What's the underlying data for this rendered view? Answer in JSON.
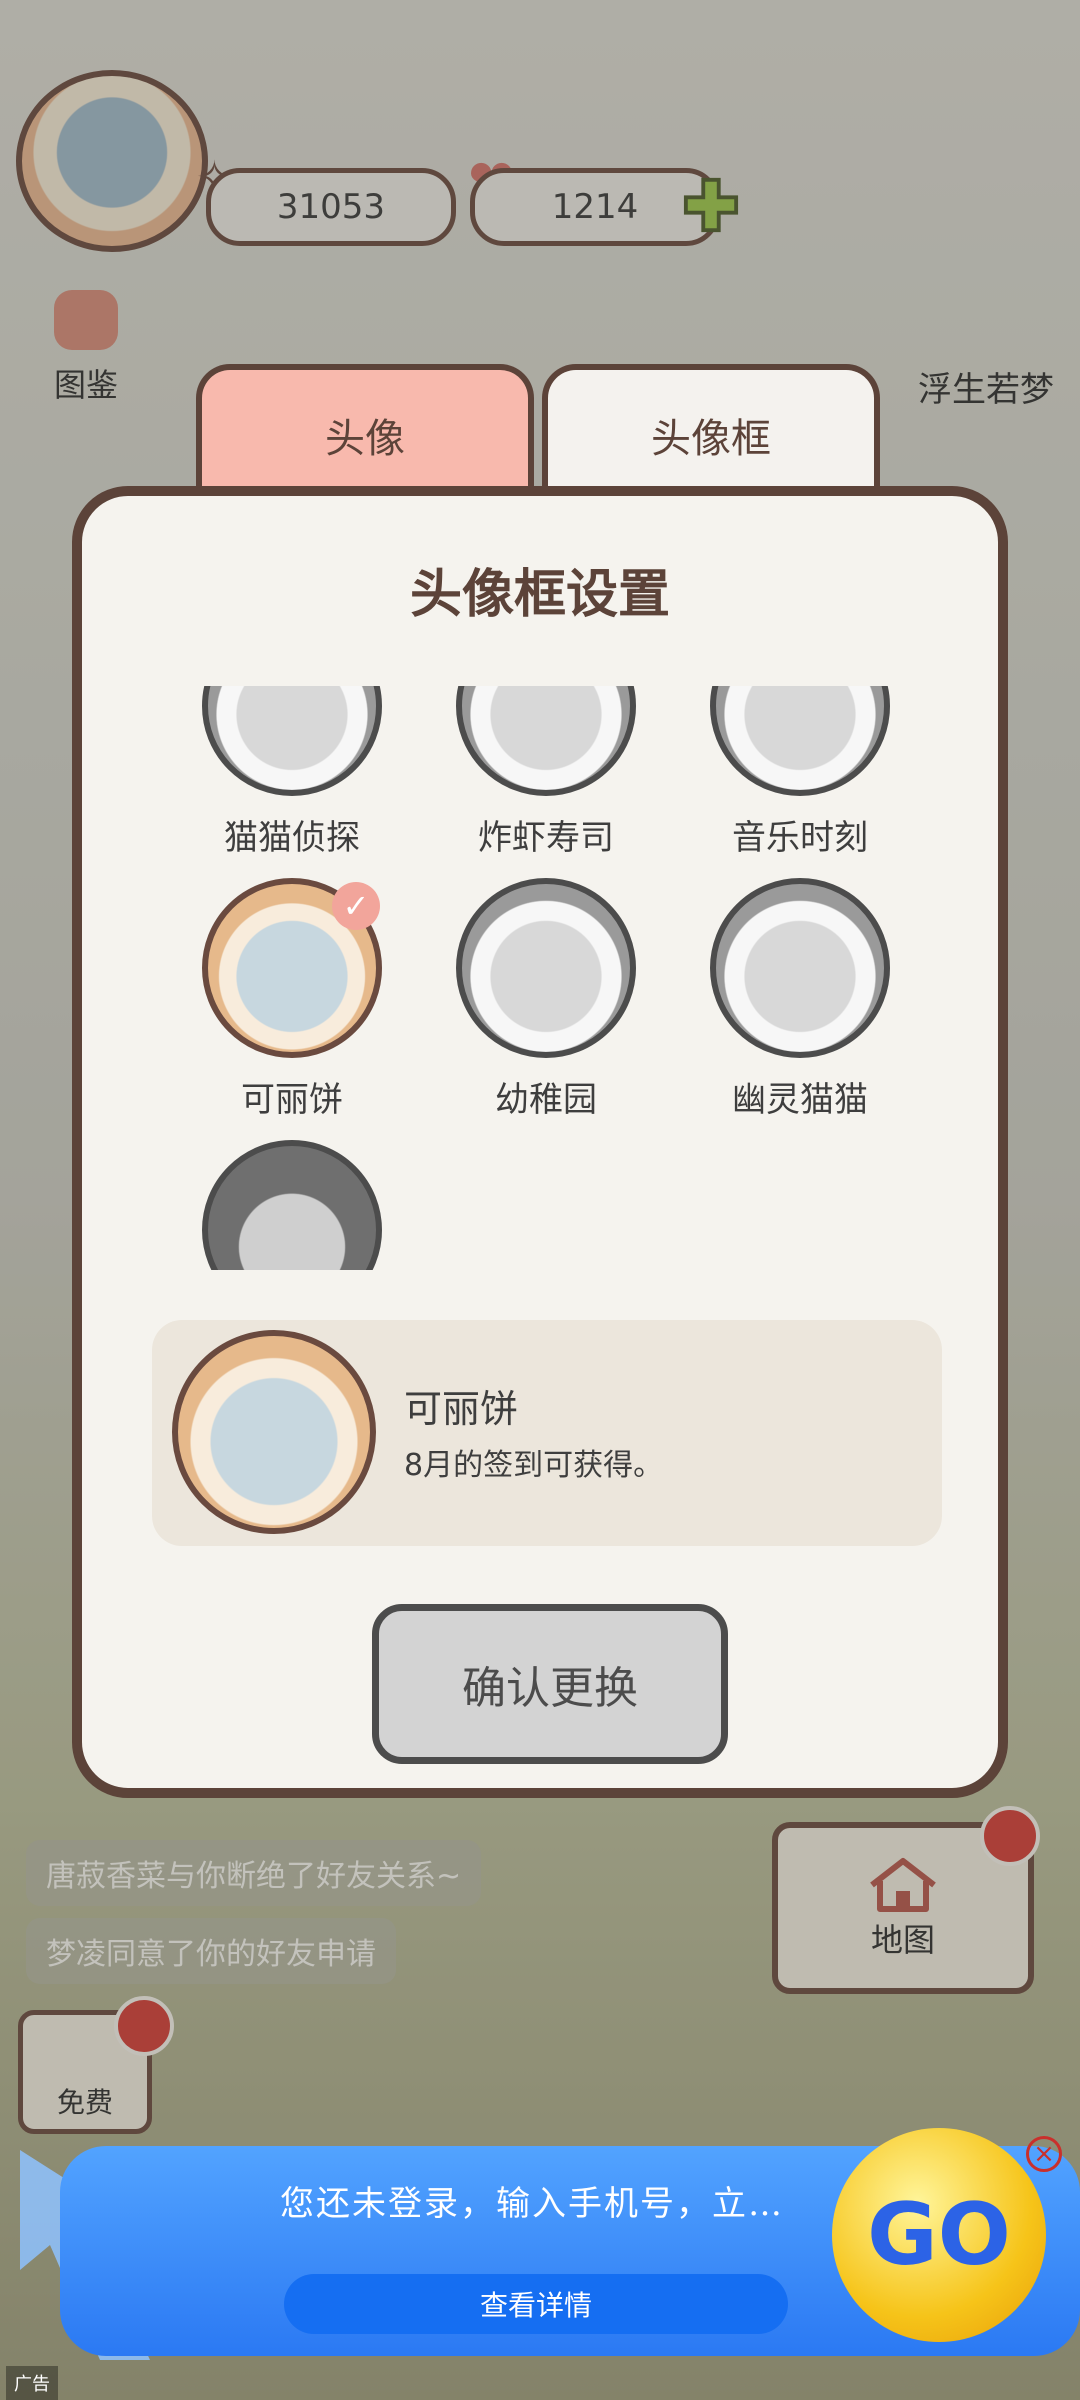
{
  "hud": {
    "fish_count": "31053",
    "heart_count": "1214"
  },
  "menu": [
    {
      "label": "图鉴"
    }
  ],
  "corner_name": "浮生若梦",
  "log_messages": [
    "唐菽香菜与你断绝了好友关系~",
    "梦凌同意了你的好友申请"
  ],
  "map_label": "地图",
  "free_label": "免费",
  "modal": {
    "tabs": [
      "头像",
      "头像框"
    ],
    "active_tab": "头像框",
    "title": "头像框设置",
    "frames": [
      {
        "name": "猫猫侦探",
        "owned": false
      },
      {
        "name": "炸虾寿司",
        "owned": false
      },
      {
        "name": "音乐时刻",
        "owned": false
      },
      {
        "name": "可丽饼",
        "owned": true,
        "selected": true
      },
      {
        "name": "幼稚园",
        "owned": false
      },
      {
        "name": "幽灵猫猫",
        "owned": false
      },
      {
        "name": "",
        "owned": false
      }
    ],
    "detail": {
      "name": "可丽饼",
      "description": "8月的签到可获得。"
    },
    "confirm_label": "确认更换"
  },
  "ad": {
    "text": "您还未登录，输入手机号，立…",
    "button_label": "查看详情",
    "go_label": "GO",
    "close": "×",
    "tag": "广告"
  },
  "colors": {
    "modal_border": "#5c4339",
    "tab_active": "#f4f2ee",
    "tab_inactive": "#f8b9ad",
    "ad_blue": "#2b79f3"
  }
}
